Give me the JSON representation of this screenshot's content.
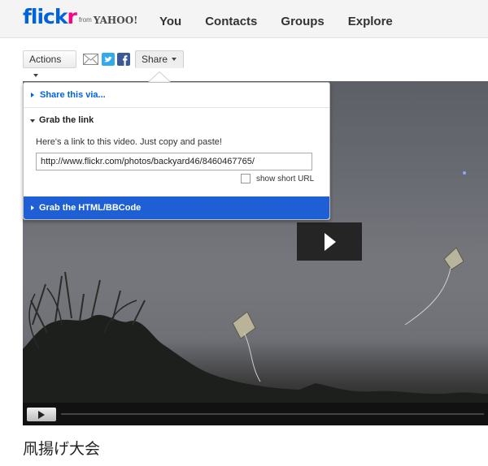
{
  "header": {
    "logo_main": "flick",
    "logo_r": "r",
    "logo_from": "from",
    "logo_yahoo": "YAHOO!",
    "nav": [
      "You",
      "Contacts",
      "Groups",
      "Explore"
    ]
  },
  "action_bar": {
    "actions_label": "Actions",
    "share_label": "Share",
    "icons": [
      "mail-icon",
      "twitter-icon",
      "facebook-icon"
    ]
  },
  "share_panel": {
    "share_via_label": "Share this via...",
    "grab_link_label": "Grab the link",
    "instructions": "Here's a link to this video. Just copy and paste!",
    "link_value": "http://www.flickr.com/photos/backyard46/8460467765/",
    "short_url_label": "show short URL",
    "html_bbcode_label": "Grab the HTML/BBCode"
  },
  "photo": {
    "title": "凧揚げ大会"
  },
  "colors": {
    "flickr_blue": "#0063dc",
    "flickr_pink": "#ff0084",
    "highlight_blue": "#1e5fd6",
    "twitter": "#33aaee",
    "facebook": "#3b5998"
  }
}
